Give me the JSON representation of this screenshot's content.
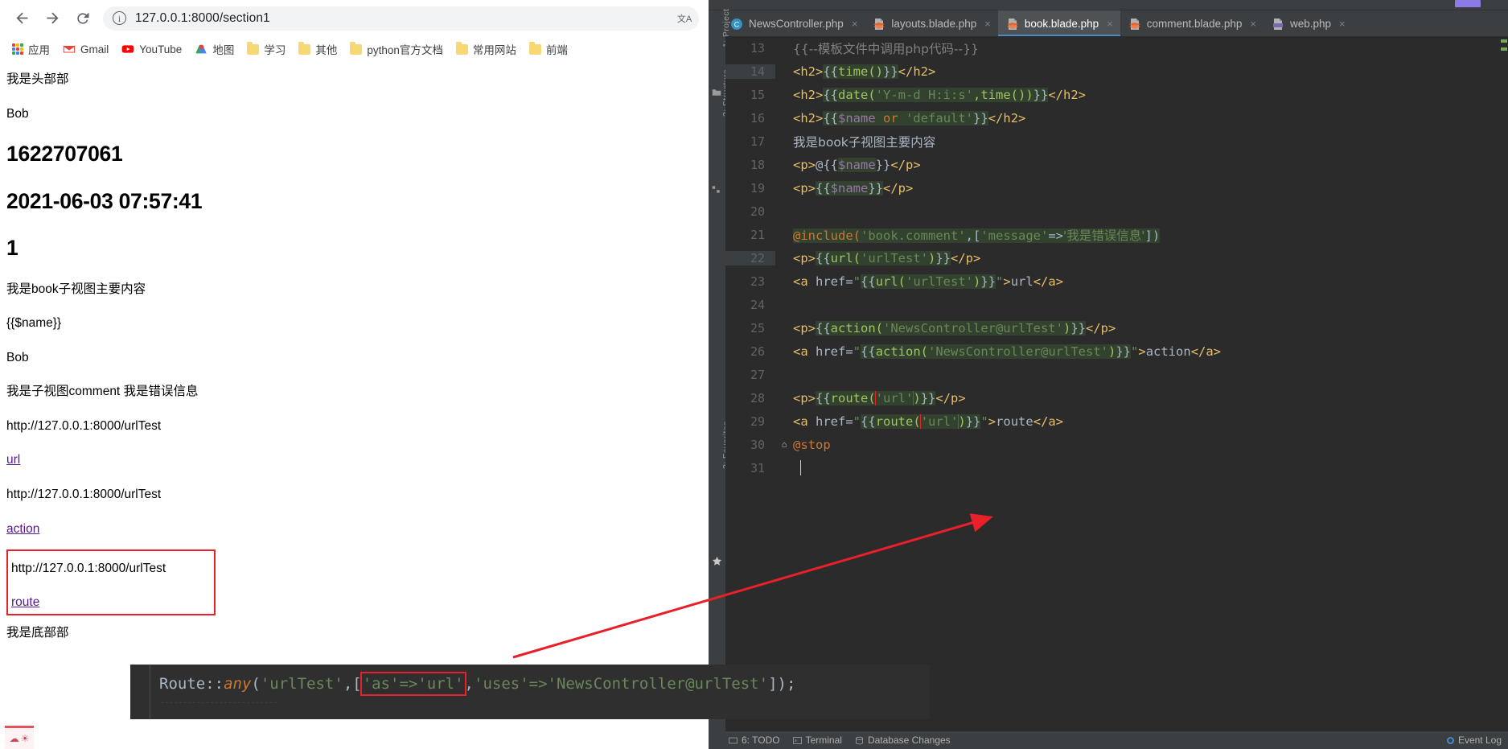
{
  "browser": {
    "nav": {
      "back_label": "Back",
      "forward_label": "Forward",
      "reload_label": "Reload"
    },
    "omnibox": {
      "url": "127.0.0.1:8000/section1",
      "info_glyph": "i",
      "translate_glyph": "文A"
    },
    "bookmarks": [
      {
        "label": "应用",
        "icon": "apps-grid-icon"
      },
      {
        "label": "Gmail",
        "icon": "gmail-icon"
      },
      {
        "label": "YouTube",
        "icon": "youtube-icon"
      },
      {
        "label": "地图",
        "icon": "maps-icon"
      },
      {
        "label": "学习",
        "icon": "folder-icon"
      },
      {
        "label": "其他",
        "icon": "folder-icon"
      },
      {
        "label": "python官方文档",
        "icon": "folder-icon"
      },
      {
        "label": "常用网站",
        "icon": "folder-icon"
      },
      {
        "label": "前端",
        "icon": "folder-icon"
      }
    ],
    "page": {
      "header_text": "我是头部部",
      "name_value": "Bob",
      "timestamp": "1622707061",
      "datetime": "2021-06-03 07:57:41",
      "section_number": "1",
      "book_main": "我是book子视图主要内容",
      "raw_blade": "{{$name}}",
      "name_echo": "Bob",
      "comment_line": "我是子视图comment 我是错误信息",
      "url_value": "http://127.0.0.1:8000/urlTest",
      "url_link": "url",
      "action_value": "http://127.0.0.1:8000/urlTest",
      "action_link": "action",
      "route_value": "http://127.0.0.1:8000/urlTest",
      "route_link": "route",
      "footer_text": "我是底部部"
    }
  },
  "ide": {
    "tabs": [
      {
        "label": "NewsController.php",
        "icon": "php-class-icon",
        "active": false,
        "close": "×"
      },
      {
        "label": "layouts.blade.php",
        "icon": "blade-file-icon",
        "active": false,
        "close": "×"
      },
      {
        "label": "book.blade.php",
        "icon": "blade-file-icon",
        "active": true,
        "close": "×"
      },
      {
        "label": "comment.blade.php",
        "icon": "blade-file-icon",
        "active": false,
        "close": "×"
      },
      {
        "label": "web.php",
        "icon": "php-file-icon",
        "active": false,
        "close": "×"
      }
    ],
    "rails": {
      "project": "1: Project",
      "structure": "2: Structure",
      "favorites": "2: Favorites"
    },
    "code": [
      {
        "num": "13",
        "changed": false,
        "fold": "",
        "tokens": [
          {
            "t": "{{--模板文件中调用php代码--}}",
            "c": "cmt cjk"
          }
        ]
      },
      {
        "num": "14",
        "changed": true,
        "fold": "",
        "tokens": [
          {
            "t": "<h2>",
            "c": "tag"
          },
          {
            "t": "{{",
            "c": "plain hl"
          },
          {
            "t": "time()",
            "c": "blade hl"
          },
          {
            "t": "}}",
            "c": "plain hl"
          },
          {
            "t": "</h2>",
            "c": "tag"
          }
        ]
      },
      {
        "num": "15",
        "changed": false,
        "fold": "",
        "tokens": [
          {
            "t": "<h2>",
            "c": "tag"
          },
          {
            "t": "{{",
            "c": "plain hl"
          },
          {
            "t": "date(",
            "c": "blade hl"
          },
          {
            "t": "'Y-m-d H:i:s'",
            "c": "str hl"
          },
          {
            "t": ",time())",
            "c": "blade hl"
          },
          {
            "t": "}}",
            "c": "plain hl"
          },
          {
            "t": "</h2>",
            "c": "tag"
          }
        ]
      },
      {
        "num": "16",
        "changed": false,
        "fold": "",
        "tokens": [
          {
            "t": "<h2>",
            "c": "tag"
          },
          {
            "t": "{{",
            "c": "plain hl"
          },
          {
            "t": "$name",
            "c": "var hl"
          },
          {
            "t": " ",
            "c": "hl"
          },
          {
            "t": "or",
            "c": "kw hl"
          },
          {
            "t": " ",
            "c": "hl"
          },
          {
            "t": "'default'",
            "c": "str hl"
          },
          {
            "t": "}}",
            "c": "plain hl"
          },
          {
            "t": "</h2>",
            "c": "tag"
          }
        ]
      },
      {
        "num": "17",
        "changed": false,
        "fold": "",
        "tokens": [
          {
            "t": "我是book子视图主要内容",
            "c": "plain cjk"
          }
        ]
      },
      {
        "num": "18",
        "changed": false,
        "fold": "",
        "tokens": [
          {
            "t": "<p>",
            "c": "tag"
          },
          {
            "t": "@{{",
            "c": "plain"
          },
          {
            "t": "$name",
            "c": "var hl"
          },
          {
            "t": "}}",
            "c": "plain"
          },
          {
            "t": "</p>",
            "c": "tag"
          }
        ]
      },
      {
        "num": "19",
        "changed": false,
        "fold": "",
        "tokens": [
          {
            "t": "<p>",
            "c": "tag"
          },
          {
            "t": "{{",
            "c": "plain hl"
          },
          {
            "t": "$name",
            "c": "var hl"
          },
          {
            "t": "}}",
            "c": "plain hl"
          },
          {
            "t": "</p>",
            "c": "tag"
          }
        ]
      },
      {
        "num": "20",
        "changed": false,
        "fold": "",
        "tokens": []
      },
      {
        "num": "21",
        "changed": false,
        "fold": "",
        "tokens": [
          {
            "t": "@include(",
            "c": "kw hl"
          },
          {
            "t": "'book.comment'",
            "c": "str hl"
          },
          {
            "t": ",[",
            "c": "plain hl"
          },
          {
            "t": "'message'",
            "c": "str hl"
          },
          {
            "t": "=>",
            "c": "plain hl"
          },
          {
            "t": "'我是错误信息'",
            "c": "str hl cjk"
          },
          {
            "t": "])",
            "c": "plain hl"
          }
        ]
      },
      {
        "num": "22",
        "changed": true,
        "fold": "",
        "tokens": [
          {
            "t": "<p>",
            "c": "tag"
          },
          {
            "t": "{{",
            "c": "plain hl"
          },
          {
            "t": "url(",
            "c": "blade hl"
          },
          {
            "t": "'urlTest'",
            "c": "str hl"
          },
          {
            "t": ")",
            "c": "blade hl"
          },
          {
            "t": "}}",
            "c": "plain hl"
          },
          {
            "t": "</p>",
            "c": "tag"
          }
        ]
      },
      {
        "num": "23",
        "changed": false,
        "fold": "",
        "tokens": [
          {
            "t": "<a",
            "c": "tag"
          },
          {
            "t": " href=",
            "c": "plain"
          },
          {
            "t": "\"",
            "c": "str"
          },
          {
            "t": "{{",
            "c": "plain hl"
          },
          {
            "t": "url(",
            "c": "blade hl"
          },
          {
            "t": "'urlTest'",
            "c": "str hl"
          },
          {
            "t": ")",
            "c": "blade hl"
          },
          {
            "t": "}}",
            "c": "plain hl"
          },
          {
            "t": "\"",
            "c": "str"
          },
          {
            "t": ">",
            "c": "tag"
          },
          {
            "t": "url",
            "c": "plain"
          },
          {
            "t": "</a>",
            "c": "tag"
          }
        ]
      },
      {
        "num": "24",
        "changed": false,
        "fold": "",
        "tokens": []
      },
      {
        "num": "25",
        "changed": false,
        "fold": "",
        "tokens": [
          {
            "t": "<p>",
            "c": "tag"
          },
          {
            "t": "{{",
            "c": "plain hl"
          },
          {
            "t": "action(",
            "c": "blade hl"
          },
          {
            "t": "'NewsController@urlTest'",
            "c": "str hl"
          },
          {
            "t": ")",
            "c": "blade hl"
          },
          {
            "t": "}}",
            "c": "plain hl"
          },
          {
            "t": "</p>",
            "c": "tag"
          }
        ]
      },
      {
        "num": "26",
        "changed": false,
        "fold": "",
        "tokens": [
          {
            "t": "<a",
            "c": "tag"
          },
          {
            "t": " href=",
            "c": "plain"
          },
          {
            "t": "\"",
            "c": "str"
          },
          {
            "t": "{{",
            "c": "plain hl"
          },
          {
            "t": "action(",
            "c": "blade hl"
          },
          {
            "t": "'NewsController@urlTest'",
            "c": "str hl"
          },
          {
            "t": ")",
            "c": "blade hl"
          },
          {
            "t": "}}",
            "c": "plain hl"
          },
          {
            "t": "\"",
            "c": "str"
          },
          {
            "t": ">",
            "c": "tag"
          },
          {
            "t": "action",
            "c": "plain"
          },
          {
            "t": "</a>",
            "c": "tag"
          }
        ]
      },
      {
        "num": "27",
        "changed": false,
        "fold": "",
        "tokens": []
      },
      {
        "num": "28",
        "changed": false,
        "fold": "",
        "tokens": [
          {
            "t": "<p>",
            "c": "tag"
          },
          {
            "t": "{{",
            "c": "plain hl"
          },
          {
            "t": "route(",
            "c": "blade hl"
          },
          {
            "t": "'url'",
            "c": "str hl redmark"
          },
          {
            "t": ")",
            "c": "blade hl"
          },
          {
            "t": "}}",
            "c": "plain hl"
          },
          {
            "t": "</p>",
            "c": "tag"
          }
        ]
      },
      {
        "num": "29",
        "changed": false,
        "fold": "",
        "tokens": [
          {
            "t": "<a",
            "c": "tag"
          },
          {
            "t": " href=",
            "c": "plain"
          },
          {
            "t": "\"",
            "c": "str"
          },
          {
            "t": "{{",
            "c": "plain hl"
          },
          {
            "t": "route(",
            "c": "blade hl"
          },
          {
            "t": "'url'",
            "c": "str hl redmark"
          },
          {
            "t": ")",
            "c": "blade hl"
          },
          {
            "t": "}}",
            "c": "plain hl"
          },
          {
            "t": "\"",
            "c": "str"
          },
          {
            "t": ">",
            "c": "tag"
          },
          {
            "t": "route",
            "c": "plain"
          },
          {
            "t": "</a>",
            "c": "tag"
          }
        ]
      },
      {
        "num": "30",
        "changed": false,
        "fold": "⌂",
        "tokens": [
          {
            "t": "@stop",
            "c": "kw"
          }
        ]
      },
      {
        "num": "31",
        "changed": false,
        "fold": "",
        "tokens": []
      }
    ],
    "route_overlay": {
      "prefix": "Route::",
      "method": "any",
      "open": "(",
      "path": "'urlTest'",
      "mid": ",[",
      "as_key": "'as'=>'url'",
      "comma": ",",
      "uses_key": "'uses'=>",
      "uses_val": "'NewsController@urlTest'",
      "close": "]);"
    },
    "status_bar": {
      "todo": "6: TODO",
      "terminal": "Terminal",
      "db_changes": "Database Changes",
      "event_log": "Event Log"
    }
  }
}
